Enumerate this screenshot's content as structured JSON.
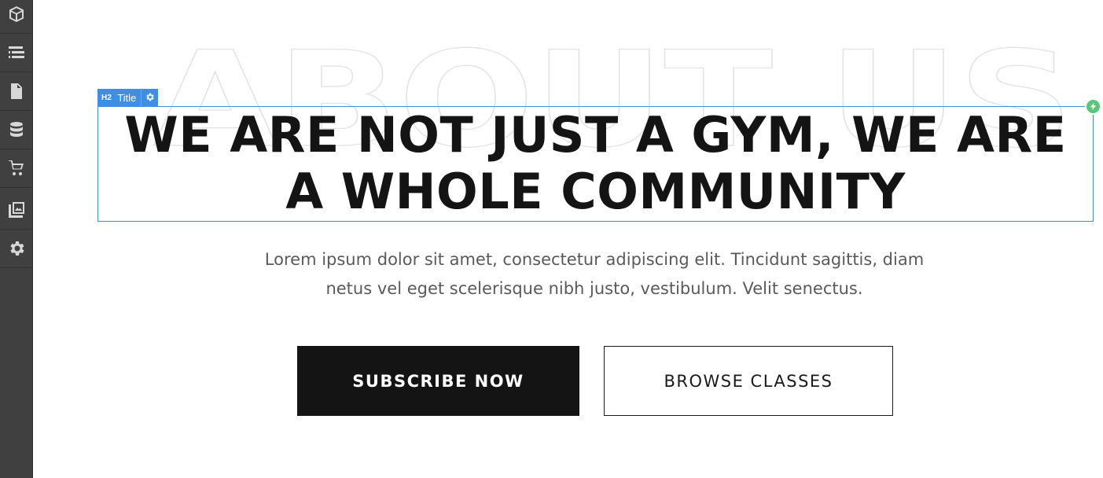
{
  "toolbar": {
    "items": [
      {
        "icon": "cube-icon"
      },
      {
        "icon": "layers-icon"
      },
      {
        "icon": "page-icon"
      },
      {
        "icon": "database-icon"
      },
      {
        "icon": "cart-icon"
      },
      {
        "icon": "assets-icon"
      },
      {
        "icon": "gear-icon"
      }
    ]
  },
  "background_word": "ABOUT US",
  "selection": {
    "tag_type": "H2",
    "tag_label": "Title",
    "accent_color": "#3f8ee6",
    "interaction_color": "#5ac67c"
  },
  "hero": {
    "title_line1": "WE ARE NOT JUST A GYM, WE ARE",
    "title_line2": "A WHOLE COMMUNITY",
    "description_line1": "Lorem ipsum dolor sit amet, consectetur adipiscing elit. Tincidunt sagittis, diam",
    "description_line2": "netus vel eget scelerisque nibh justo, vestibulum. Velit senectus."
  },
  "buttons": {
    "primary_label": "SUBSCRIBE NOW",
    "secondary_label": "BROWSE CLASSES"
  }
}
